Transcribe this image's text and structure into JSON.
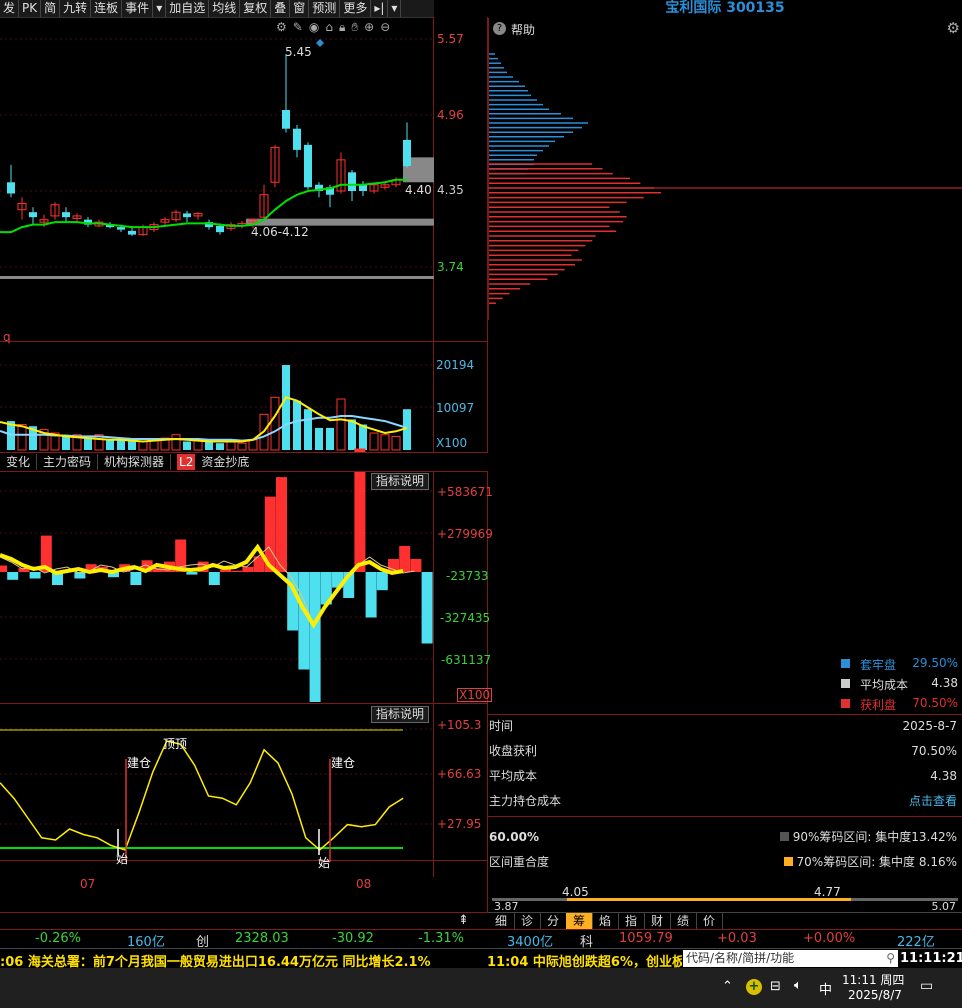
{
  "toolbar": {
    "items": [
      "发",
      "PK",
      "简",
      "九转",
      "连板",
      "事件",
      "▾",
      "加自选",
      "均线",
      "复权",
      "叠",
      "窗",
      "预测",
      "更多",
      "▸|",
      "▾"
    ]
  },
  "stock_title": "宝利国际 300135",
  "help_label": "帮助",
  "price_axis": {
    "labels": [
      "5.57",
      "4.96",
      "4.35",
      "3.74"
    ],
    "high_label": "5.45",
    "low_range_label": "4.06-4.12",
    "current_label": "4.40"
  },
  "vol_axis": {
    "labels": [
      "20194",
      "10097",
      "X100"
    ]
  },
  "left_label_q": "q",
  "indicator_tabs": [
    "变化",
    "主力密码",
    "机构探测器",
    "L2",
    "资金抄底"
  ],
  "explain_label": "指标说明",
  "ind1_axis": {
    "labels": [
      "+583671",
      "+279969",
      "-23733",
      "-327435",
      "-631137",
      "X100"
    ]
  },
  "ind2_axis": {
    "labels": [
      "+105.3",
      "+66.63",
      "+27.95"
    ]
  },
  "ind2_marks": {
    "build1": "建仓",
    "build2": "建仓",
    "top": "顶顶",
    "bottom1": "始",
    "bottom2": "始"
  },
  "month_labels": [
    "07",
    "08"
  ],
  "chip_panel": {
    "legend": [
      {
        "label": "套牢盘",
        "value": "29.50%",
        "color": "#2b8fd8"
      },
      {
        "label": "平均成本",
        "value": "4.38",
        "color": "#cccccc"
      },
      {
        "label": "获利盘",
        "value": "70.50%",
        "color": "#e03030"
      }
    ],
    "rows": [
      {
        "label": "时间",
        "value": "2025-8-7"
      },
      {
        "label": "收盘获利",
        "value": "70.50%"
      },
      {
        "label": "平均成本",
        "value": "4.38"
      },
      {
        "label": "主力持仓成本",
        "value": "点击查看"
      }
    ],
    "pct60": "60.00%",
    "conc90": "90%筹码区间: 集中度13.42%",
    "overlap_label": "区间重合度",
    "conc70": "70%筹码区间: 集中度 8.16%",
    "range_min": "3.87",
    "range_a": "4.05",
    "range_b": "4.77",
    "range_max": "5.07",
    "range_fill": [
      0.16,
      0.77
    ]
  },
  "bottom_tabs": [
    "细",
    "诊",
    "分",
    "筹",
    "焰",
    "指",
    "财",
    "绩",
    "价"
  ],
  "ticker": {
    "a": "-0.26%",
    "b": "160亿",
    "c": "创",
    "d": "2328.03",
    "e": "-30.92",
    "f": "-1.31%",
    "g": "3400亿",
    "h": "科",
    "i": "1059.79",
    "j": "+0.03",
    "k": "+0.00%",
    "l": "222亿"
  },
  "news": {
    "left": ":06 海关总署：前7个月我国一般贸易进出口16.44万亿元 同比增长2.1%",
    "right": "11:04 中际旭创跌超6%，创业板",
    "search_placeholder": "代码/名称/简拼/功能",
    "clock": "11:11:21"
  },
  "taskbar": {
    "time": "11:11 周四",
    "date": "2025/8/7",
    "ime": "中"
  },
  "colors": {
    "up": "#ff3030",
    "down": "#4fe0f0",
    "ma_yellow": "#ffee00",
    "ma_green": "#00e000"
  },
  "candles": [
    {
      "o": 4.42,
      "c": 4.33,
      "h": 4.56,
      "l": 4.3
    },
    {
      "o": 4.2,
      "c": 4.25,
      "h": 4.3,
      "l": 4.12
    },
    {
      "o": 4.18,
      "c": 4.14,
      "h": 4.22,
      "l": 4.08
    },
    {
      "o": 4.1,
      "c": 4.12,
      "h": 4.16,
      "l": 4.06
    },
    {
      "o": 4.15,
      "c": 4.24,
      "h": 4.26,
      "l": 4.12
    },
    {
      "o": 4.18,
      "c": 4.14,
      "h": 4.22,
      "l": 4.1
    },
    {
      "o": 4.13,
      "c": 4.15,
      "h": 4.17,
      "l": 4.1
    },
    {
      "o": 4.12,
      "c": 4.08,
      "h": 4.14,
      "l": 4.06
    },
    {
      "o": 4.07,
      "c": 4.1,
      "h": 4.12,
      "l": 4.06
    },
    {
      "o": 4.08,
      "c": 4.06,
      "h": 4.1,
      "l": 4.05
    },
    {
      "o": 4.06,
      "c": 4.04,
      "h": 4.08,
      "l": 4.02
    },
    {
      "o": 4.03,
      "c": 4.0,
      "h": 4.06,
      "l": 3.99
    },
    {
      "o": 4.0,
      "c": 4.06,
      "h": 4.08,
      "l": 3.99
    },
    {
      "o": 4.04,
      "c": 4.08,
      "h": 4.1,
      "l": 4.02
    },
    {
      "o": 4.1,
      "c": 4.12,
      "h": 4.14,
      "l": 4.07
    },
    {
      "o": 4.12,
      "c": 4.18,
      "h": 4.2,
      "l": 4.1
    },
    {
      "o": 4.17,
      "c": 4.14,
      "h": 4.19,
      "l": 4.1
    },
    {
      "o": 4.15,
      "c": 4.17,
      "h": 4.18,
      "l": 4.12
    },
    {
      "o": 4.1,
      "c": 4.06,
      "h": 4.12,
      "l": 4.04
    },
    {
      "o": 4.07,
      "c": 4.02,
      "h": 4.09,
      "l": 4.0
    },
    {
      "o": 4.05,
      "c": 4.08,
      "h": 4.1,
      "l": 4.03
    },
    {
      "o": 4.07,
      "c": 4.09,
      "h": 4.11,
      "l": 4.05
    },
    {
      "o": 4.1,
      "c": 4.12,
      "h": 4.13,
      "l": 4.05
    },
    {
      "o": 4.14,
      "c": 4.32,
      "h": 4.4,
      "l": 4.12
    },
    {
      "o": 4.42,
      "c": 4.7,
      "h": 4.72,
      "l": 4.38
    },
    {
      "o": 5.0,
      "c": 4.85,
      "h": 5.45,
      "l": 4.82
    },
    {
      "o": 4.85,
      "c": 4.68,
      "h": 4.88,
      "l": 4.62
    },
    {
      "o": 4.72,
      "c": 4.38,
      "h": 4.74,
      "l": 4.36
    },
    {
      "o": 4.4,
      "c": 4.35,
      "h": 4.42,
      "l": 4.3
    },
    {
      "o": 4.38,
      "c": 4.32,
      "h": 4.4,
      "l": 4.22
    },
    {
      "o": 4.35,
      "c": 4.6,
      "h": 4.66,
      "l": 4.33
    },
    {
      "o": 4.5,
      "c": 4.35,
      "h": 4.52,
      "l": 4.27
    },
    {
      "o": 4.4,
      "c": 4.35,
      "h": 4.43,
      "l": 4.31
    },
    {
      "o": 4.35,
      "c": 4.4,
      "h": 4.42,
      "l": 4.33
    },
    {
      "o": 4.38,
      "c": 4.4,
      "h": 4.42,
      "l": 4.36
    },
    {
      "o": 4.4,
      "c": 4.44,
      "h": 4.46,
      "l": 4.38
    },
    {
      "o": 4.76,
      "c": 4.55,
      "h": 4.9,
      "l": 4.54
    }
  ],
  "volumes": [
    0.34,
    0.3,
    0.28,
    0.24,
    0.2,
    0.16,
    0.18,
    0.14,
    0.18,
    0.12,
    0.14,
    0.12,
    0.1,
    0.12,
    0.14,
    0.18,
    0.1,
    0.12,
    0.1,
    0.08,
    0.1,
    0.08,
    0.12,
    0.42,
    0.62,
    1.0,
    0.58,
    0.48,
    0.26,
    0.26,
    0.6,
    0.36,
    0.3,
    0.2,
    0.18,
    0.16,
    0.48
  ],
  "main_force": [
    0.05,
    -0.06,
    0.03,
    -0.05,
    0.28,
    -0.1,
    0.02,
    -0.05,
    0.06,
    0.04,
    -0.04,
    0.06,
    -0.1,
    0.09,
    0.03,
    0.08,
    0.25,
    -0.02,
    0.08,
    -0.1,
    0.02,
    0.01,
    0.04,
    0.12,
    0.58,
    0.73,
    -0.45,
    -0.75,
    -1.0,
    -0.25,
    -0.12,
    -0.2,
    0.95,
    -0.35,
    -0.14,
    0.1,
    0.2,
    0.1,
    -0.55
  ],
  "ind2_line": [
    0.62,
    0.48,
    0.3,
    0.12,
    0.1,
    0.2,
    0.15,
    0.12,
    0.05,
    0.01,
    0.35,
    0.72,
    1.0,
    0.97,
    0.78,
    0.5,
    0.48,
    0.42,
    0.62,
    0.92,
    0.8,
    0.52,
    0.12,
    0.01,
    0.12,
    0.24,
    0.22,
    0.24,
    0.4,
    0.48
  ],
  "chip_up": [
    0.04,
    0.06,
    0.08,
    0.1,
    0.12,
    0.16,
    0.2,
    0.24,
    0.26,
    0.28,
    0.32,
    0.36,
    0.4,
    0.48,
    0.56,
    0.66,
    0.62,
    0.56,
    0.5,
    0.44,
    0.4,
    0.36,
    0.32,
    0.3,
    0.3,
    0.26,
    0.24
  ],
  "chip_down": [
    0.6,
    0.66,
    0.72,
    0.82,
    0.88,
    0.96,
    1.0,
    0.9,
    0.8,
    0.7,
    0.76,
    0.8,
    0.78,
    0.7,
    0.74,
    0.62,
    0.6,
    0.56,
    0.52,
    0.48,
    0.54,
    0.5,
    0.44,
    0.4,
    0.34,
    0.24,
    0.18,
    0.12,
    0.08,
    0.04
  ]
}
